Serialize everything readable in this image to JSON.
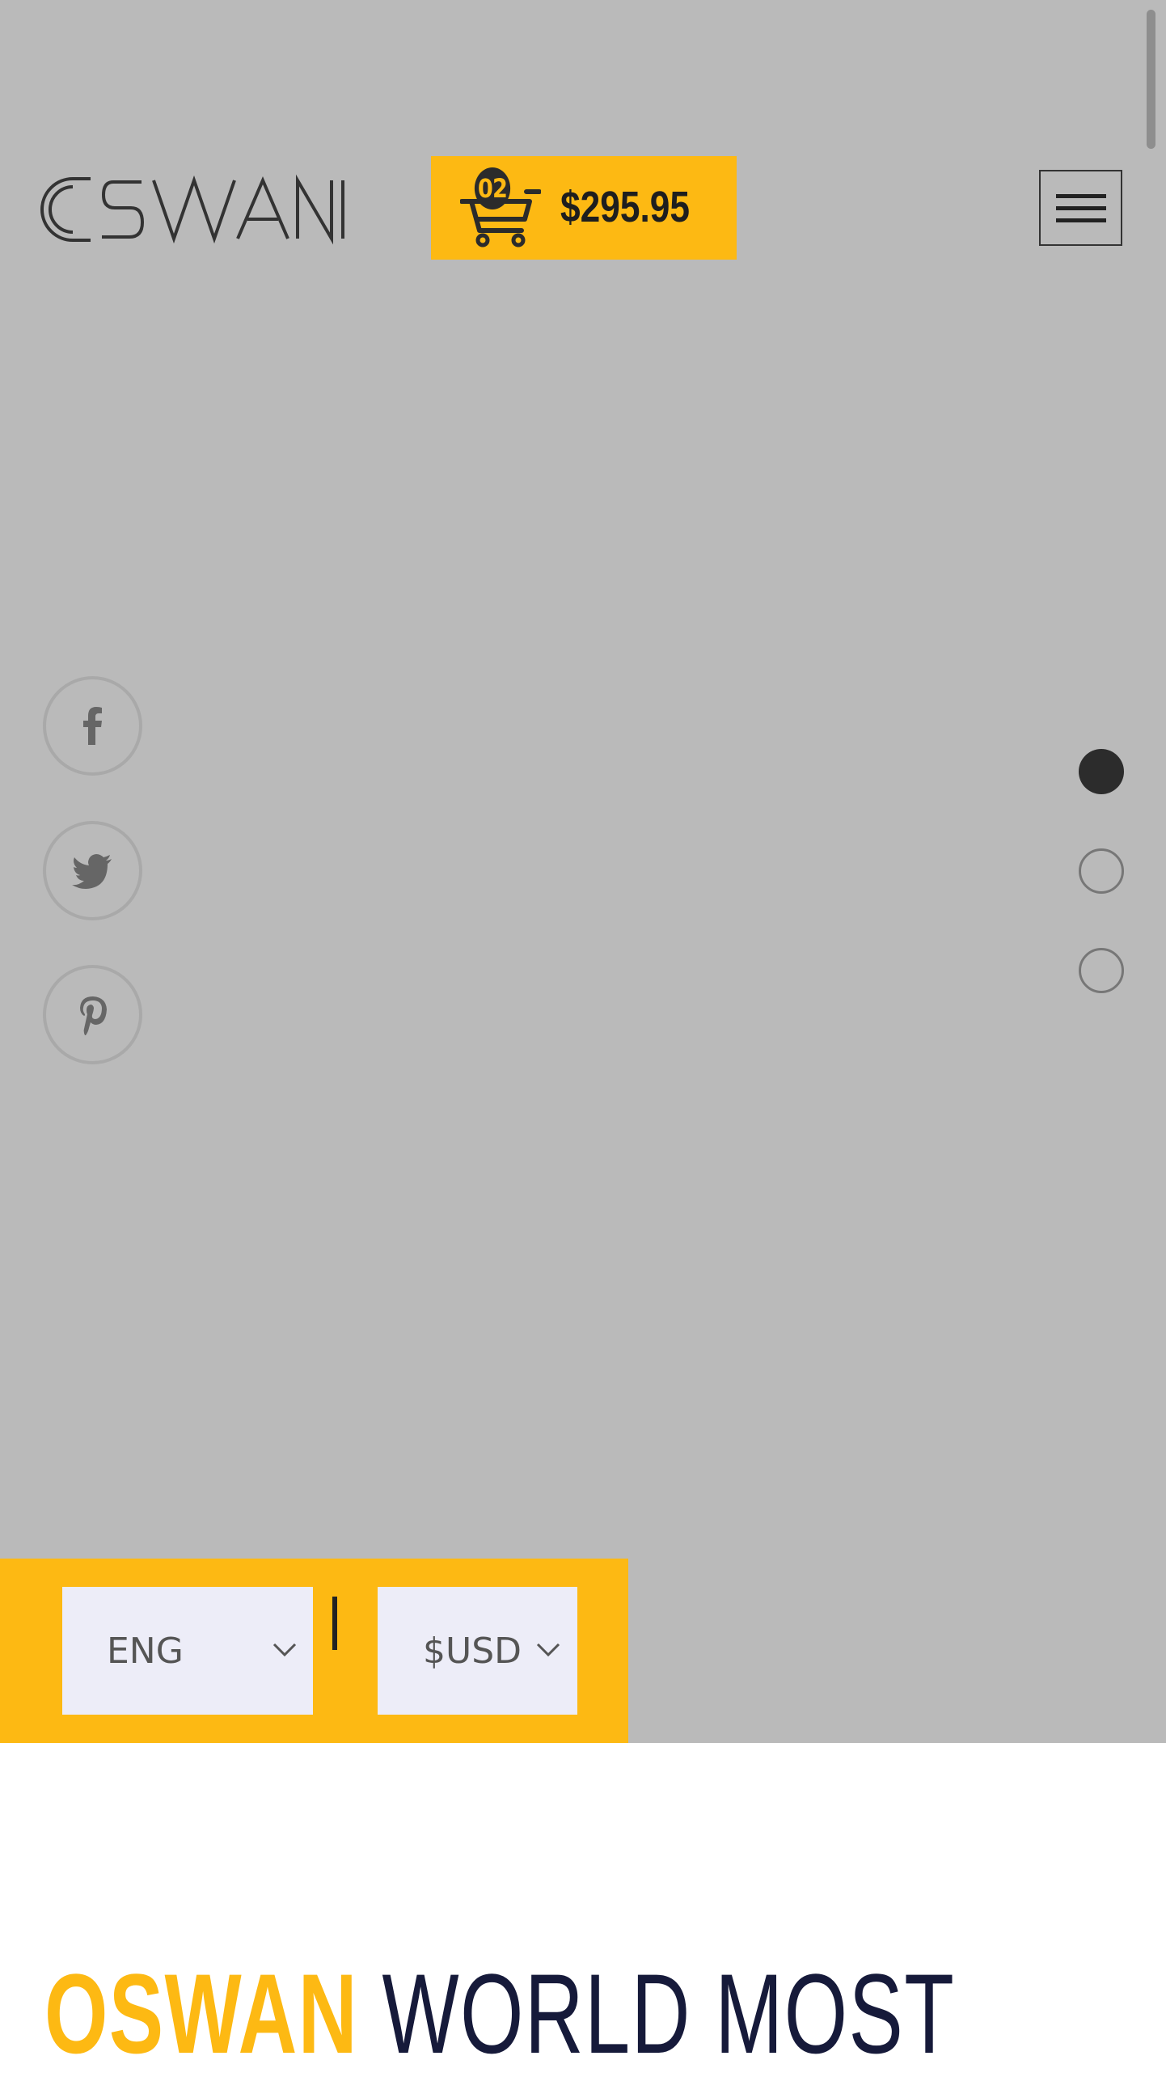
{
  "header": {
    "logo_text": "OSWAN",
    "cart": {
      "count": "02",
      "total": "$295.95"
    },
    "menu_icon": "hamburger-menu-icon"
  },
  "social": [
    {
      "name": "facebook",
      "icon": "facebook-icon"
    },
    {
      "name": "twitter",
      "icon": "twitter-icon"
    },
    {
      "name": "pinterest",
      "icon": "pinterest-icon"
    }
  ],
  "slider": {
    "active_index": 1,
    "total": 3
  },
  "switcher": {
    "language": {
      "value": "ENG"
    },
    "currency": {
      "value": "$USD"
    }
  },
  "headline": {
    "brand": "OSWAN",
    "rest": "WORLD MOST"
  },
  "colors": {
    "accent": "#fdb913",
    "hero_bg": "#bababa",
    "dark": "#161a3a"
  }
}
